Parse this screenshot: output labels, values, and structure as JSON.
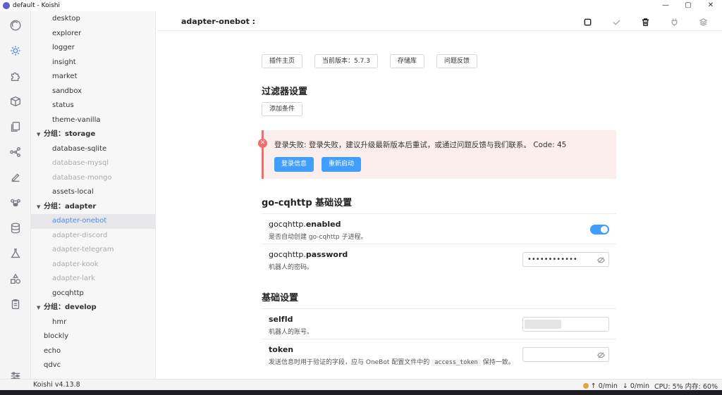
{
  "window": {
    "title": "default - Koishi",
    "controls": [
      "—",
      "▢",
      "✕"
    ]
  },
  "sidebar": {
    "items": [
      {
        "label": "desktop",
        "kind": "lv1"
      },
      {
        "label": "explorer",
        "kind": "lv1"
      },
      {
        "label": "logger",
        "kind": "lv1"
      },
      {
        "label": "insight",
        "kind": "lv1"
      },
      {
        "label": "market",
        "kind": "lv1"
      },
      {
        "label": "sandbox",
        "kind": "lv1"
      },
      {
        "label": "status",
        "kind": "lv1"
      },
      {
        "label": "theme-vanilla",
        "kind": "lv1"
      },
      {
        "label": "分组：storage",
        "kind": "group"
      },
      {
        "label": "database-sqlite",
        "kind": "lv1"
      },
      {
        "label": "database-mysql",
        "kind": "lv1 disabled"
      },
      {
        "label": "database-mongo",
        "kind": "lv1 disabled"
      },
      {
        "label": "assets-local",
        "kind": "lv1"
      },
      {
        "label": "分组：adapter",
        "kind": "group"
      },
      {
        "label": "adapter-onebot",
        "kind": "lv1 active"
      },
      {
        "label": "adapter-discord",
        "kind": "lv1 disabled"
      },
      {
        "label": "adapter-telegram",
        "kind": "lv1 disabled"
      },
      {
        "label": "adapter-kook",
        "kind": "lv1 disabled"
      },
      {
        "label": "adapter-lark",
        "kind": "lv1 disabled"
      },
      {
        "label": "gocqhttp",
        "kind": "lv1"
      },
      {
        "label": "分组：develop",
        "kind": "group"
      },
      {
        "label": "hmr",
        "kind": "lv1"
      },
      {
        "label": "blockly",
        "kind": "lv0"
      },
      {
        "label": "echo",
        "kind": "lv0"
      },
      {
        "label": "qdvc",
        "kind": "lv0"
      }
    ]
  },
  "header": {
    "title": "adapter-onebot :"
  },
  "toolbar": {
    "plugin_home": "插件主页",
    "version": "当前版本：5.7.3",
    "repo": "存储库",
    "feedback": "问题反馈"
  },
  "filter": {
    "title": "过滤器设置",
    "add_condition": "添加条件"
  },
  "error": {
    "message": "登录失败: 登录失败，建议升级最新版本后重试，或通过问题反馈与我们联系。 Code: 45",
    "login_info": "登录信息",
    "restart": "重新启动"
  },
  "gocq": {
    "title": "go-cqhttp 基础设置",
    "enabled_prefix": "gocqhttp.",
    "enabled_key": "enabled",
    "enabled_desc": "是否自动创建 go-cqhttp 子进程。",
    "enabled_value": true,
    "password_prefix": "gocqhttp.",
    "password_key": "password",
    "password_desc": "机器人的密码。",
    "password_value": "••••••••••••"
  },
  "basic": {
    "title": "基础设置",
    "selfid_label": "selfId",
    "selfid_desc": "机器人的账号。",
    "token_label": "token",
    "token_desc_pre": "发送信息时用于验证的字段，应与 OneBot 配置文件中的",
    "token_desc_code": "access_token",
    "token_desc_post": "保持一致。"
  },
  "status": {
    "version": "Koishi v4.13.8",
    "up": "0/min",
    "down": "0/min",
    "cpu_mem": "CPU: 5% 内存: 60%"
  },
  "colors": {
    "accent": "#409eff",
    "error_bg": "#fdeeee",
    "error": "#f56c6c"
  }
}
